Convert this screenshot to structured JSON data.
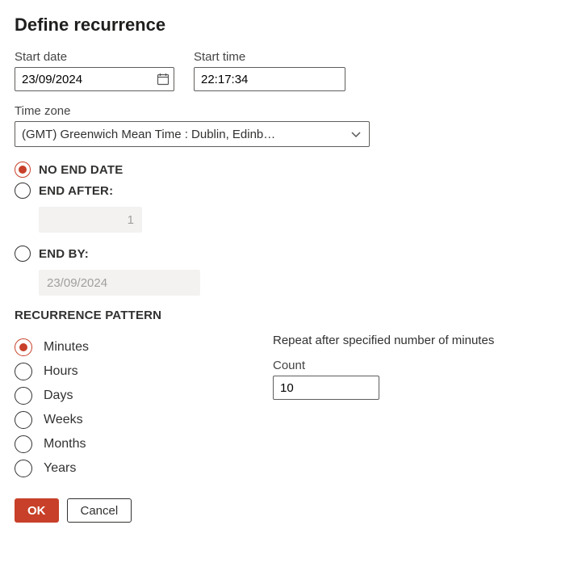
{
  "title": "Define recurrence",
  "start_date": {
    "label": "Start date",
    "value": "23/09/2024"
  },
  "start_time": {
    "label": "Start time",
    "value": "22:17:34"
  },
  "time_zone": {
    "label": "Time zone",
    "selected": "(GMT) Greenwich Mean Time : Dublin, Edinb…"
  },
  "end": {
    "no_end": "NO END DATE",
    "end_after": "END AFTER:",
    "end_after_value": "1",
    "end_by": "END BY:",
    "end_by_value": "23/09/2024",
    "selected": "no_end"
  },
  "pattern_header": "RECURRENCE PATTERN",
  "pattern_options": {
    "minutes": "Minutes",
    "hours": "Hours",
    "days": "Days",
    "weeks": "Weeks",
    "months": "Months",
    "years": "Years",
    "selected": "minutes"
  },
  "repeat": {
    "description": "Repeat after specified number of minutes",
    "count_label": "Count",
    "count_value": "10"
  },
  "buttons": {
    "ok": "OK",
    "cancel": "Cancel"
  }
}
